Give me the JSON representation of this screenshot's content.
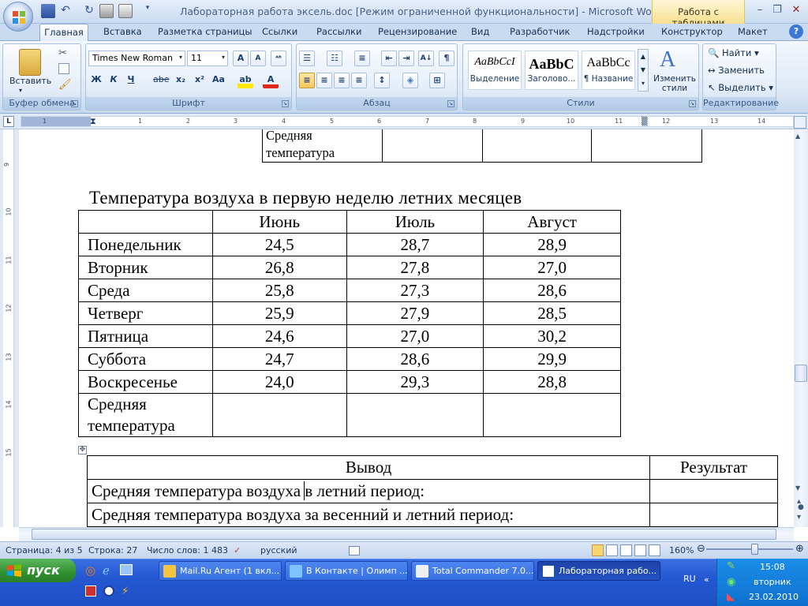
{
  "titlebar": {
    "title": "Лабораторная работа эксель.doc [Режим ограниченной функциональности] - Microsoft Word",
    "context_tab": "Работа с таблицами"
  },
  "tabs": [
    "Главная",
    "Вставка",
    "Разметка страницы",
    "Ссылки",
    "Рассылки",
    "Рецензирование",
    "Вид",
    "Разработчик",
    "Надстройки",
    "Конструктор",
    "Макет"
  ],
  "ribbon": {
    "clipboard": {
      "label": "Буфер обмена",
      "paste": "Вставить"
    },
    "font": {
      "label": "Шрифт",
      "name": "Times New Roman",
      "size": "11",
      "bold": "Ж",
      "italic": "К",
      "underline": "Ч",
      "strike": "abe",
      "sub": "x₂",
      "sup": "x²",
      "case": "Aa",
      "grow": "A",
      "shrink": "A"
    },
    "paragraph": {
      "label": "Абзац",
      "pilcrow": "¶"
    },
    "styles": {
      "label": "Стили",
      "items": [
        {
          "sample": "AaBbCcI",
          "name": "Выделение"
        },
        {
          "sample": "AaBbC",
          "name": "Заголово..."
        },
        {
          "sample": "AaBbCc",
          "name": "¶ Название"
        }
      ],
      "change": "Изменить стили"
    },
    "editing": {
      "label": "Редактирование",
      "find": "Найти",
      "replace": "Заменить",
      "select": "Выделить"
    }
  },
  "ruler": {
    "marks": [
      "1",
      "1",
      "2",
      "3",
      "4",
      "5",
      "6",
      "7",
      "8",
      "9",
      "10",
      "11",
      "12",
      "13",
      "14"
    ]
  },
  "vruler": {
    "marks": [
      "9",
      "10",
      "11",
      "12",
      "13",
      "14",
      "15"
    ]
  },
  "document": {
    "prev_table": {
      "row_label": "Средняя температура"
    },
    "heading": "Температура воздуха в первую неделю летних месяцев",
    "temp_table": {
      "headers": [
        "",
        "Июнь",
        "Июль",
        "Август"
      ],
      "rows": [
        [
          "Понедельник",
          "24,5",
          "28,7",
          "28,9"
        ],
        [
          "Вторник",
          "26,8",
          "27,8",
          "27,0"
        ],
        [
          "Среда",
          "25,8",
          "27,3",
          "28,6"
        ],
        [
          "Четверг",
          "25,9",
          "27,9",
          "28,5"
        ],
        [
          "Пятница",
          "24,6",
          "27,0",
          "30,2"
        ],
        [
          "Суббота",
          "24,7",
          "28,6",
          "29,9"
        ],
        [
          "Воскресенье",
          "24,0",
          "29,3",
          "28,8"
        ]
      ],
      "avg_label": "Средняя температура"
    },
    "conclusion_table": {
      "headers": [
        "Вывод",
        "Результат"
      ],
      "rows": [
        "Средняя температура воздуха в летний период:",
        "Средняя температура воздуха за весенний и летний период:"
      ]
    }
  },
  "status": {
    "page": "Страница: 4 из 5",
    "line": "Строка: 27",
    "words": "Число слов: 1 483",
    "language": "русский",
    "zoom": "160%"
  },
  "taskbar": {
    "start": "пуск",
    "tasks": [
      "Mail.Ru Агент (1 вкл...",
      "В Контакте | Олимп ...",
      "Total Commander 7.0...",
      "Лабораторная рабо..."
    ],
    "lang": "RU",
    "time": "15:08",
    "day": "вторник",
    "date": "23.02.2010"
  },
  "colors": {
    "ribbon": "#dde8f6",
    "taskbar": "#2457d1",
    "start": "#2f8f2f",
    "context": "#f7e08f"
  }
}
